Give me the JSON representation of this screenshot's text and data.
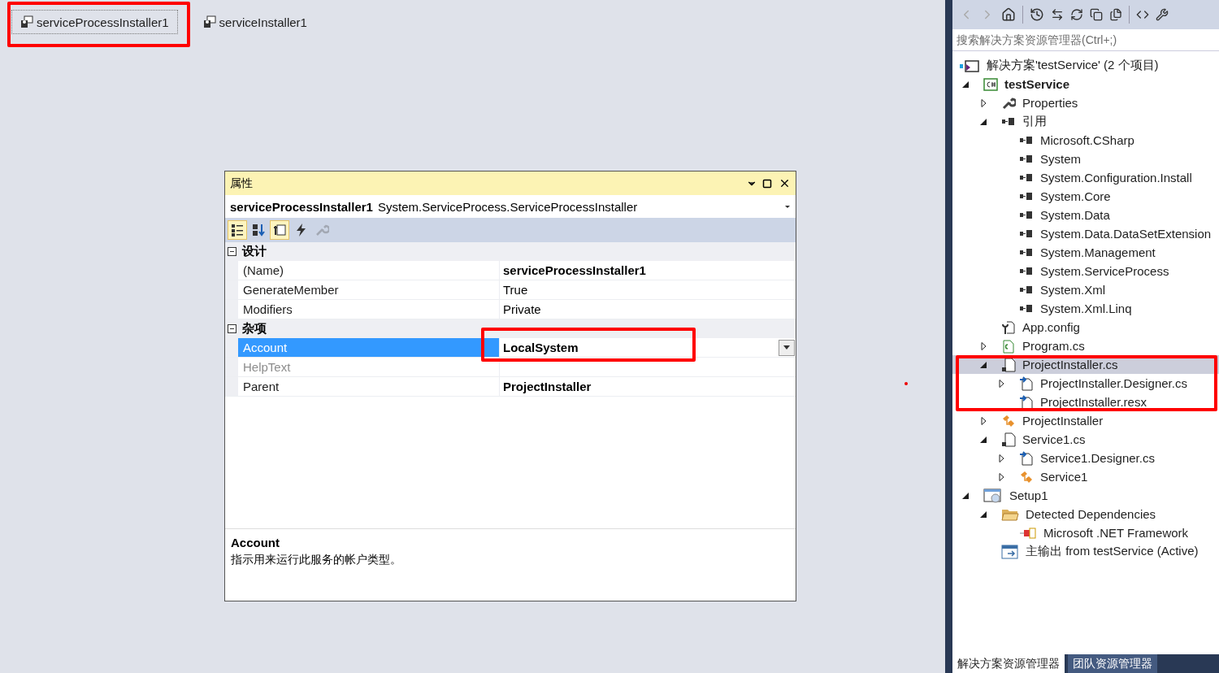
{
  "designer": {
    "components": [
      {
        "label": "serviceProcessInstaller1",
        "selected": true
      },
      {
        "label": "serviceInstaller1",
        "selected": false
      }
    ]
  },
  "properties": {
    "title": "属性",
    "object_name": "serviceProcessInstaller1",
    "object_type": "System.ServiceProcess.ServiceProcessInstaller",
    "toolbar": [
      {
        "kind": "categorized",
        "selected": true,
        "disabled": false
      },
      {
        "kind": "alphabetical",
        "selected": false,
        "disabled": false
      },
      {
        "kind": "properties",
        "selected": true,
        "disabled": false
      },
      {
        "kind": "events",
        "selected": false,
        "disabled": false
      },
      {
        "kind": "pages",
        "selected": false,
        "disabled": true
      }
    ],
    "categories": [
      {
        "name": "设计",
        "expanded": true,
        "rows": [
          {
            "name": "(Name)",
            "value": "serviceProcessInstaller1",
            "bold": true,
            "selected": false,
            "disabled": false,
            "dropdown": false
          },
          {
            "name": "GenerateMember",
            "value": "True",
            "bold": false,
            "selected": false,
            "disabled": false,
            "dropdown": false
          },
          {
            "name": "Modifiers",
            "value": "Private",
            "bold": false,
            "selected": false,
            "disabled": false,
            "dropdown": false
          }
        ]
      },
      {
        "name": "杂项",
        "expanded": true,
        "rows": [
          {
            "name": "Account",
            "value": "LocalSystem",
            "bold": true,
            "selected": true,
            "disabled": false,
            "dropdown": true
          },
          {
            "name": "HelpText",
            "bold": false,
            "selected": false,
            "disabled": true,
            "dropdown": false
          },
          {
            "name": "Parent",
            "value": "ProjectInstaller",
            "bold": true,
            "selected": false,
            "disabled": false,
            "dropdown": false
          }
        ]
      }
    ],
    "description": {
      "title": "Account",
      "text": "指示用来运行此服务的帐户类型。"
    }
  },
  "solution_explorer": {
    "search": {
      "placeholder": "搜索解决方案资源管理器(Ctrl+;)"
    },
    "tree": [
      {
        "label": "解决方案'testService' (2 个项目)",
        "kind": "solution",
        "bold": false,
        "selected": false,
        "children": [
          {
            "label": "testService",
            "kind": "csproj",
            "bold": true,
            "selected": false,
            "expanded": true,
            "children": [
              {
                "label": "Properties",
                "kind": "wrench",
                "bold": false,
                "selected": false,
                "expanded": false
              },
              {
                "label": "引用",
                "kind": "reference",
                "bold": false,
                "selected": false,
                "expanded": true,
                "children": [
                  {
                    "label": "Microsoft.CSharp",
                    "kind": "reference",
                    "bold": false,
                    "selected": false
                  },
                  {
                    "label": "System",
                    "kind": "reference",
                    "bold": false,
                    "selected": false
                  },
                  {
                    "label": "System.Configuration.Install",
                    "kind": "reference",
                    "bold": false,
                    "selected": false
                  },
                  {
                    "label": "System.Core",
                    "kind": "reference",
                    "bold": false,
                    "selected": false
                  },
                  {
                    "label": "System.Data",
                    "kind": "reference",
                    "bold": false,
                    "selected": false
                  },
                  {
                    "label": "System.Data.DataSetExtension",
                    "kind": "reference",
                    "bold": false,
                    "selected": false
                  },
                  {
                    "label": "System.Management",
                    "kind": "reference",
                    "bold": false,
                    "selected": false
                  },
                  {
                    "label": "System.ServiceProcess",
                    "kind": "reference",
                    "bold": false,
                    "selected": false
                  },
                  {
                    "label": "System.Xml",
                    "kind": "reference",
                    "bold": false,
                    "selected": false
                  },
                  {
                    "label": "System.Xml.Linq",
                    "kind": "reference",
                    "bold": false,
                    "selected": false
                  }
                ]
              },
              {
                "label": "App.config",
                "kind": "config",
                "bold": false,
                "selected": false
              },
              {
                "label": "Program.cs",
                "kind": "csfile",
                "bold": false,
                "selected": false,
                "expanded": false
              },
              {
                "label": "ProjectInstaller.cs",
                "kind": "component",
                "bold": false,
                "selected": true,
                "expanded": true,
                "children": [
                  {
                    "label": "ProjectInstaller.Designer.cs",
                    "kind": "designer",
                    "bold": false,
                    "selected": false,
                    "expanded": false
                  },
                  {
                    "label": "ProjectInstaller.resx",
                    "kind": "designer",
                    "bold": false,
                    "selected": false
                  }
                ]
              },
              {
                "label": "ProjectInstaller",
                "kind": "class",
                "bold": false,
                "selected": false,
                "expanded": false
              },
              {
                "label": "Service1.cs",
                "kind": "component",
                "bold": false,
                "selected": false,
                "expanded": true,
                "children": [
                  {
                    "label": "Service1.Designer.cs",
                    "kind": "designer",
                    "bold": false,
                    "selected": false,
                    "expanded": false
                  },
                  {
                    "label": "Service1",
                    "kind": "class",
                    "bold": false,
                    "selected": false,
                    "expanded": false
                  }
                ]
              }
            ]
          },
          {
            "label": "Setup1",
            "kind": "setup",
            "bold": false,
            "selected": false,
            "expanded": true,
            "children": [
              {
                "label": "Detected Dependencies",
                "kind": "folder",
                "bold": false,
                "selected": false,
                "expanded": true,
                "children": [
                  {
                    "label": "Microsoft .NET Framework",
                    "kind": "dependency",
                    "bold": false,
                    "selected": false
                  }
                ]
              },
              {
                "label": "主输出 from testService (Active)",
                "kind": "output",
                "bold": false,
                "selected": false
              }
            ]
          }
        ]
      }
    ],
    "tabs": [
      {
        "label": "解决方案资源管理器",
        "selected": true
      },
      {
        "label": "团队资源管理器",
        "selected": false
      }
    ]
  }
}
